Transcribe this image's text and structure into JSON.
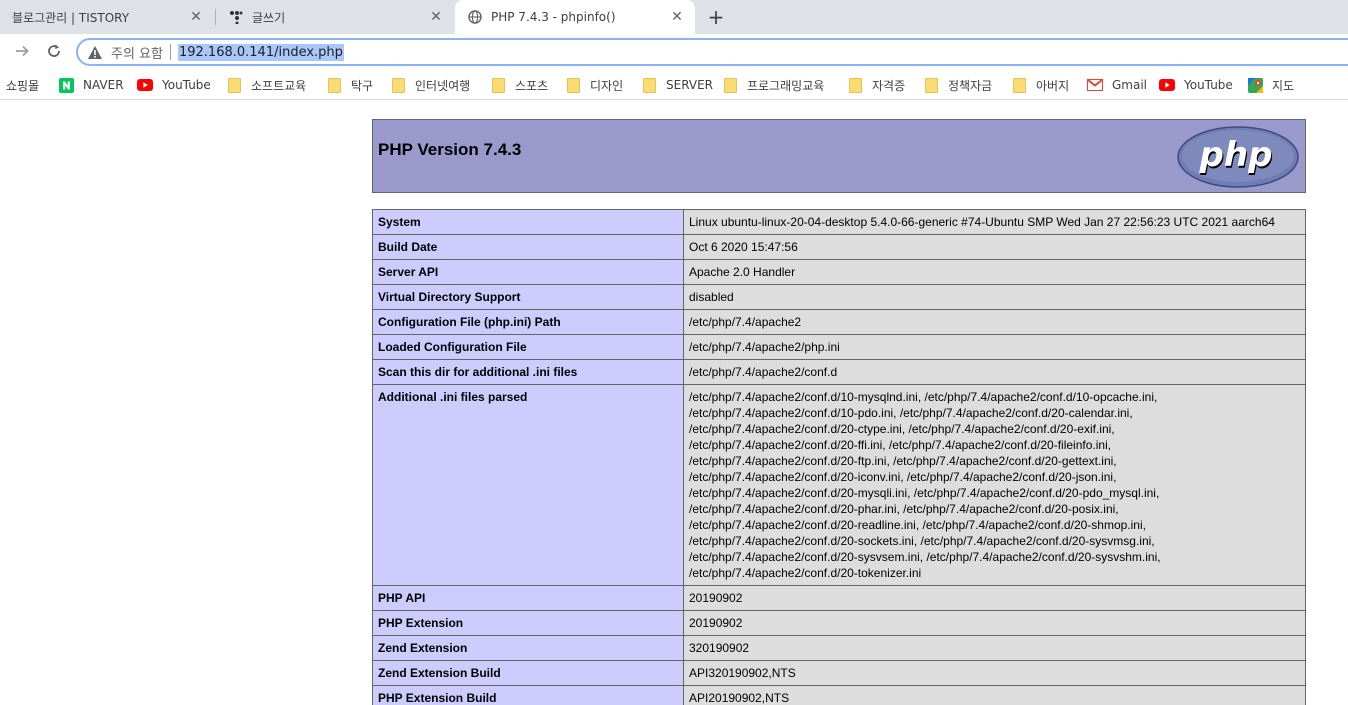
{
  "browser": {
    "tabs": [
      {
        "title": "블로그관리 | TISTORY",
        "icon": "tistory-icon",
        "active": false
      },
      {
        "title": "글쓰기",
        "icon": "tistory-dots-icon",
        "active": false
      },
      {
        "title": "PHP 7.4.3 - phpinfo()",
        "icon": "globe-icon",
        "active": true
      }
    ],
    "new_tab_symbol": "+",
    "close_symbol": "✕",
    "security_warning": "주의 요함",
    "url": "192.168.0.141/index.php"
  },
  "bookmarks": [
    {
      "label": "쇼핑몰",
      "icon": "none"
    },
    {
      "label": "NAVER",
      "icon": "naver-icon"
    },
    {
      "label": "YouTube",
      "icon": "youtube-icon"
    },
    {
      "label": "소프트교육",
      "icon": "folder-icon"
    },
    {
      "label": "탁구",
      "icon": "folder-icon"
    },
    {
      "label": "인터넷여행",
      "icon": "folder-icon"
    },
    {
      "label": "스포츠",
      "icon": "folder-icon"
    },
    {
      "label": "디자인",
      "icon": "folder-icon"
    },
    {
      "label": "SERVER",
      "icon": "folder-icon"
    },
    {
      "label": "프로그래밍교육",
      "icon": "folder-icon"
    },
    {
      "label": "자격증",
      "icon": "folder-icon"
    },
    {
      "label": "정책자금",
      "icon": "folder-icon"
    },
    {
      "label": "아버지",
      "icon": "folder-icon"
    },
    {
      "label": "Gmail",
      "icon": "gmail-icon"
    },
    {
      "label": "YouTube",
      "icon": "youtube-icon"
    },
    {
      "label": "지도",
      "icon": "maps-icon"
    }
  ],
  "phpinfo": {
    "heading": "PHP Version 7.4.3",
    "logo_text": "php",
    "rows": [
      {
        "key": "System",
        "value": "Linux ubuntu-linux-20-04-desktop 5.4.0-66-generic #74-Ubuntu SMP Wed Jan 27 22:56:23 UTC 2021 aarch64"
      },
      {
        "key": "Build Date",
        "value": "Oct 6 2020 15:47:56"
      },
      {
        "key": "Server API",
        "value": "Apache 2.0 Handler"
      },
      {
        "key": "Virtual Directory Support",
        "value": "disabled"
      },
      {
        "key": "Configuration File (php.ini) Path",
        "value": "/etc/php/7.4/apache2"
      },
      {
        "key": "Loaded Configuration File",
        "value": "/etc/php/7.4/apache2/php.ini"
      },
      {
        "key": "Scan this dir for additional .ini files",
        "value": "/etc/php/7.4/apache2/conf.d"
      }
    ],
    "additional_ini": {
      "key": "Additional .ini files parsed",
      "lines": [
        "/etc/php/7.4/apache2/conf.d/10-mysqlnd.ini, /etc/php/7.4/apache2/conf.d/10-opcache.ini,",
        "/etc/php/7.4/apache2/conf.d/10-pdo.ini, /etc/php/7.4/apache2/conf.d/20-calendar.ini,",
        "/etc/php/7.4/apache2/conf.d/20-ctype.ini, /etc/php/7.4/apache2/conf.d/20-exif.ini,",
        "/etc/php/7.4/apache2/conf.d/20-ffi.ini, /etc/php/7.4/apache2/conf.d/20-fileinfo.ini,",
        "/etc/php/7.4/apache2/conf.d/20-ftp.ini, /etc/php/7.4/apache2/conf.d/20-gettext.ini,",
        "/etc/php/7.4/apache2/conf.d/20-iconv.ini, /etc/php/7.4/apache2/conf.d/20-json.ini,",
        "/etc/php/7.4/apache2/conf.d/20-mysqli.ini, /etc/php/7.4/apache2/conf.d/20-pdo_mysql.ini,",
        "/etc/php/7.4/apache2/conf.d/20-phar.ini, /etc/php/7.4/apache2/conf.d/20-posix.ini,",
        "/etc/php/7.4/apache2/conf.d/20-readline.ini, /etc/php/7.4/apache2/conf.d/20-shmop.ini,",
        "/etc/php/7.4/apache2/conf.d/20-sockets.ini, /etc/php/7.4/apache2/conf.d/20-sysvmsg.ini,",
        "/etc/php/7.4/apache2/conf.d/20-sysvsem.ini, /etc/php/7.4/apache2/conf.d/20-sysvshm.ini,",
        "/etc/php/7.4/apache2/conf.d/20-tokenizer.ini"
      ]
    },
    "rows_after": [
      {
        "key": "PHP API",
        "value": "20190902"
      },
      {
        "key": "PHP Extension",
        "value": "20190902"
      },
      {
        "key": "Zend Extension",
        "value": "320190902"
      },
      {
        "key": "Zend Extension Build",
        "value": "API320190902,NTS"
      },
      {
        "key": "PHP Extension Build",
        "value": "API20190902,NTS"
      }
    ]
  },
  "colors": {
    "header_bg": "#9999cc",
    "key_cell_bg": "#ccccff",
    "value_cell_bg": "#dddddd",
    "tabstrip_bg": "#dee1e6",
    "url_highlight": "#a8c7fa"
  }
}
